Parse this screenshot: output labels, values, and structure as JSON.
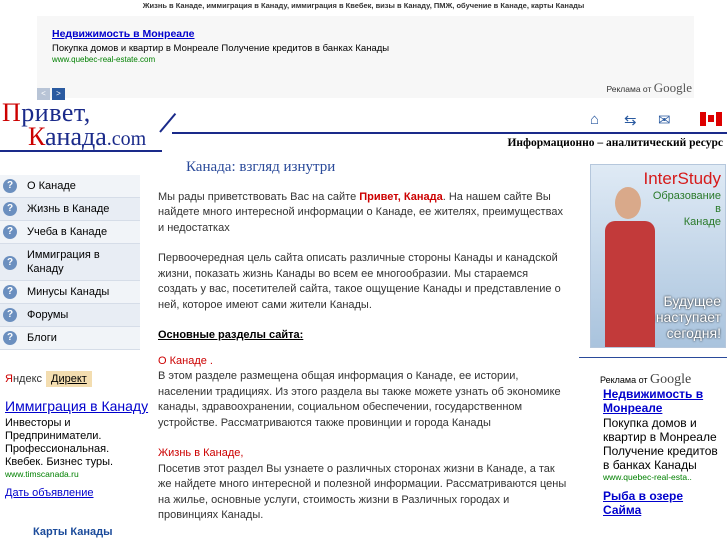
{
  "top_text": "Жизнь в Канаде, иммиграция в Канаду, иммиграция в Квебек, визы в Канаду, ПМЖ, обучение в Канаде, карты Канады",
  "top_ad": {
    "title": "Недвижимость в Монреале",
    "desc": "Покупка домов и квартир в Монреале Получение кредитов в банках Канады",
    "url": "www.quebec-real-estate.com",
    "prev": "<",
    "next": ">",
    "google_prefix": "Реклама от",
    "google": "Google"
  },
  "logo": {
    "l1_red": "П",
    "l1": "ривет,",
    "l2_red": "К",
    "l2": "анада",
    "l2_com": ".com"
  },
  "tagline": "Информационно – аналитический ресурс",
  "header_icons": [
    "home-icon",
    "sitemap-icon",
    "mail-icon",
    "canada-flag-icon"
  ],
  "menu": [
    {
      "label": "О Канаде",
      "icon": "?"
    },
    {
      "label": "Жизнь в Канаде",
      "icon": "?"
    },
    {
      "label": "Учеба в Канаде",
      "icon": "?"
    },
    {
      "label": "Иммиграция в Канаду",
      "icon": "?"
    },
    {
      "label": "Минусы Канады",
      "icon": "?"
    },
    {
      "label": "Форумы",
      "icon": "?"
    },
    {
      "label": "Блоги",
      "icon": "?"
    }
  ],
  "yandex": {
    "ya": "Я",
    "ndex": "ндекс",
    "direct": "Директ",
    "title": "Иммиграция в Канаду",
    "desc": "Инвесторы и Предприниматели. Профессиональная. Квебек. Бизнес туры.",
    "url": "www.timscanada.ru",
    "post": "Дать объявление"
  },
  "maps_link": "Карты Канады",
  "main": {
    "title": "Канада: взгляд изнутри",
    "p1_a": "Мы рады приветствовать Вас на сайте",
    "p1_red1": "Привет,",
    "p1_red2": "Канада",
    "p1_b": ". На нашем сайте Вы найдете много интересной информации о Канаде, ее жителях, преимуществах и недостатках",
    "p2": "Первоочередная цель сайта   описать различные стороны Канады и канадской жизни, показать жизнь Канады во всем ее многообразии. Мы стараемся создать у вас, посетителей сайта, такое ощущение Канады и представление о ней, которое имеют сами жители Канады.",
    "sections_title": "Основные разделы сайта:",
    "s1_title": "О Канаде .",
    "s1_text": "В этом разделе размещена общая информация о Канаде, ее истории, населении традициях. Из этого раздела вы также можете узнать об экономике канады, здравоохранении, социальном обеспечении, государственном устройстве. Рассматриваются также провинции и города Канады",
    "s2_title": "Жизнь в Канаде,",
    "s2_text": "Посетив этот раздел  Вы узнаете о различных сторонах жизни в Канаде, а так же найдете много интересной и полезной информации. Рассматриваются цены на жилье, основные услуги, стоимость жизни в Различных городах и провинциях Канады."
  },
  "banner": {
    "brand": "InterStudy",
    "sub1": "Образование",
    "sub2": "в",
    "sub3": "Канаде",
    "slogan1": "Будущее",
    "slogan2": "наступает",
    "slogan3": "сегодня!"
  },
  "right_ad": {
    "google_prefix": "Реклама от",
    "google": "Google",
    "title": "Недвижимость в Монреале",
    "desc": "Покупка домов и квартир в Монреале Получение кредитов в банках Канады",
    "url": "www.quebec-real-esta..",
    "title2": "Рыба в озере",
    "title2b": "Сайма"
  }
}
